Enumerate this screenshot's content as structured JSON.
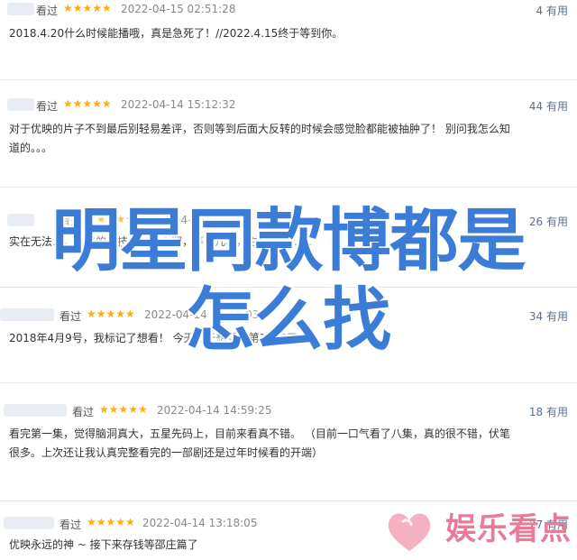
{
  "reviews": [
    {
      "status": "看过",
      "stars": "★★★★★",
      "date": "2022-04-15 02:51:28",
      "votes": "4 有用",
      "lines": [
        "2018.4.20什么时候能播哦，真是急死了！//2022.4.15终于等到你。"
      ]
    },
    {
      "status": "看过",
      "stars": "★★★★★",
      "date": "2022-04-14 15:12:32",
      "votes": "44 有用",
      "lines": [
        "对于优映的片子不到最后别轻易差评，否则等到后面大反转的时候会感觉脸都能被抽肿了！ 别问我怎么知",
        "道的。。。"
      ]
    },
    {
      "status": "看过",
      "stars": "★★★★★",
      "date": "2022-04-14 ……",
      "votes": "26 有用",
      "lines": [
        "实在无法…，大家的演技都炒好大啊，等了几年，主公实力……"
      ]
    },
    {
      "status": "看过",
      "stars": "★★★★★",
      "date": "2022-04-14 15:19:03",
      "votes": "34 有用",
      "lines": [
        "2018年4月9号，我标记了想看！ 今天终于想看的第1416天"
      ]
    },
    {
      "status": "看过",
      "stars": "★★★★★",
      "date": "2022-04-14 14:59:25",
      "votes": "18 有用",
      "lines": [
        "看完第一集，觉得脑洞真大，五星先码上，目前来看真不错。 （目前一口气看了八集，真的很不错，伏笔",
        "很多。上次还让我认真完整看完的一部剧还是过年时候看的开端）"
      ]
    },
    {
      "status": "看过",
      "stars": "★★★★★",
      "date": "2022-04-14 13:18:05",
      "votes": "27 有用",
      "lines": [
        "优映永远的神 ~ 接下来存钱等邵庄篇了"
      ]
    }
  ],
  "overlay": {
    "line1": "明星同款博都是",
    "line2": "怎么找"
  },
  "watermark": {
    "text": "娱乐看点",
    "color": "#e97a98"
  },
  "colors": {
    "accent": "#3b7cd6",
    "star": "#ffad0d",
    "votes": "#5b6f8e"
  }
}
